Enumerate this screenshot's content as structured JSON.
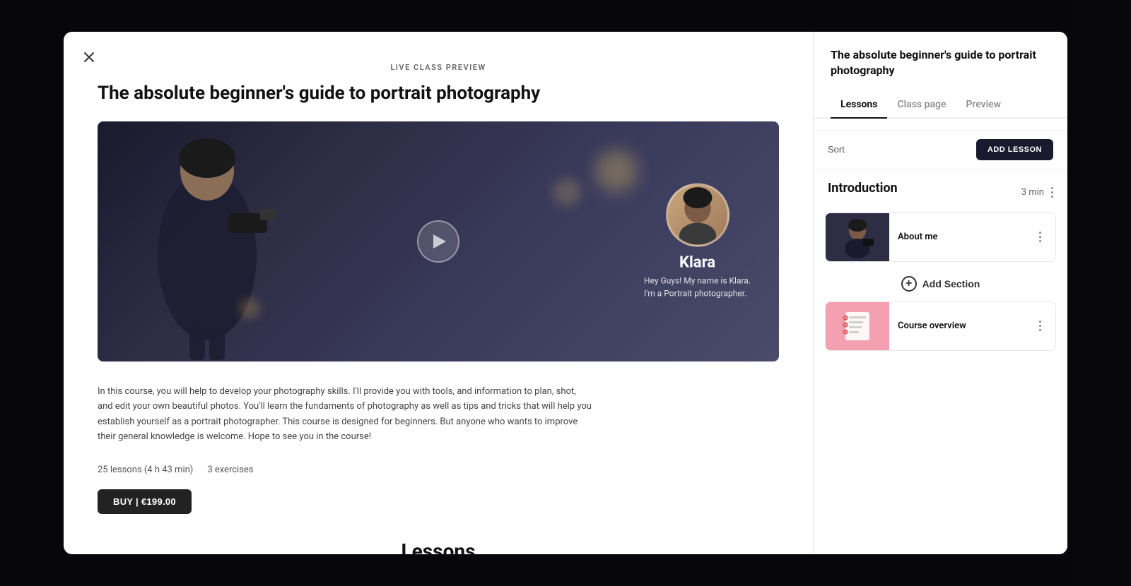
{
  "modal": {
    "live_badge": "LIVE CLASS PREVIEW",
    "close_label": "×",
    "course_title_left": "The absolute beginner's guide to portrait photography",
    "hero_alt": "Portrait photography course hero image"
  },
  "instructor": {
    "name": "Klara",
    "bio_line1": "Hey Guys! My name is Klara.",
    "bio_line2": "I'm a Portrait photographer."
  },
  "description": "In this course, you will help to develop your photography skills. I'll provide you with tools, and information to plan, shot, and edit your own beautiful photos. You'll learn the fundaments of photography as well as tips and tricks that will help you establish yourself as a portrait photographer. This course is designed for beginners. But anyone who wants to improve their general knowledge is welcome. Hope to see you in the course!",
  "meta": {
    "lessons_count": "25 lessons (4 h 43 min)",
    "exercises_count": "3 exercises"
  },
  "buy_button": "BUY | €199.00",
  "lessons_heading": "Lessons",
  "right_panel": {
    "title": "The absolute beginner's guide to portrait photography",
    "tabs": [
      {
        "label": "Lessons",
        "active": true
      },
      {
        "label": "Class page",
        "active": false
      },
      {
        "label": "Preview",
        "active": false
      }
    ],
    "sort_label": "Sort",
    "add_lesson_label": "ADD LESSON",
    "section_title": "Introduction",
    "section_duration": "3 min",
    "lessons": [
      {
        "title": "About me",
        "thumb_style": "dark"
      },
      {
        "title": "Course overview",
        "thumb_style": "pink"
      }
    ],
    "add_section_label": "Add Section"
  }
}
